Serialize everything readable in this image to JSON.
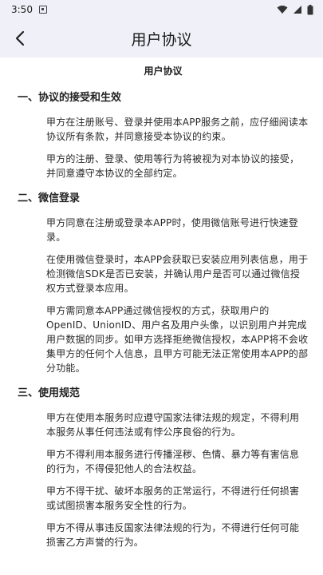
{
  "status": {
    "time": "3:50"
  },
  "app_bar": {
    "title": "用户协议"
  },
  "document": {
    "title": "用户协议",
    "sections": [
      {
        "heading": "一、协议的接受和生效",
        "paragraphs": [
          "甲方在注册账号、登录并使用本APP服务之前，应仔细阅读本协议所有条款，并同意接受本协议的约束。",
          "甲方的注册、登录、使用等行为将被视为对本协议的接受，并同意遵守本协议的全部约定。"
        ]
      },
      {
        "heading": "二、微信登录",
        "paragraphs": [
          "甲方同意在注册或登录本APP时，使用微信账号进行快速登录。",
          "在使用微信登录时，本APP会获取已安装应用列表信息，用于检测微信SDK是否已安装，并确认用户是否可以通过微信授权方式登录本应用。",
          "甲方需同意本APP通过微信授权的方式，获取用户的OpenID、UnionID、用户名及用户头像，以识别用户并完成用户数据的同步。如甲方选择拒绝微信授权，本APP将不会收集甲方的任何个人信息，且甲方可能无法正常使用本APP的部分功能。"
        ]
      },
      {
        "heading": "三、使用规范",
        "paragraphs": [
          "甲方在使用本服务时应遵守国家法律法规的规定，不得利用本服务从事任何违法或有悖公序良俗的行为。",
          "甲方不得利用本服务进行传播淫秽、色情、暴力等有害信息的行为，不得侵犯他人的合法权益。",
          "甲方不得干扰、破坏本服务的正常运行，不得进行任何损害或试图损害本服务安全性的行为。",
          "甲方不得从事违反国家法律法规的行为，不得进行任何可能损害乙方声誉的行为。"
        ]
      }
    ]
  }
}
